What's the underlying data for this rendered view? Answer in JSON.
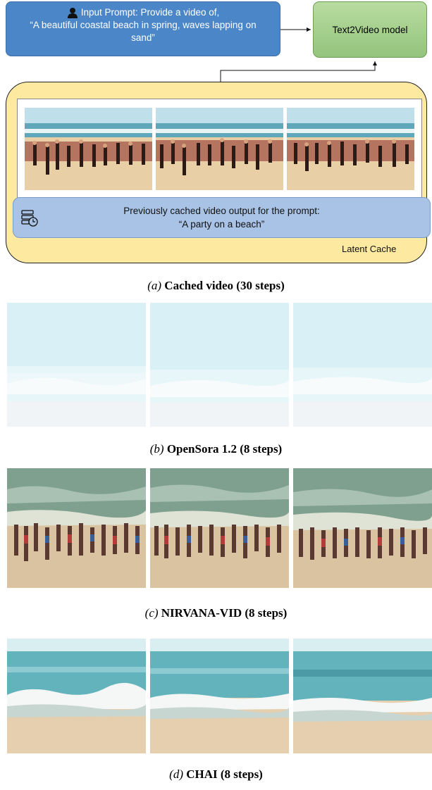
{
  "prompt": {
    "line1": "Input Prompt: Provide a video of,",
    "line2": "“A beautiful coastal beach in spring, waves lapping on",
    "line3": "sand”"
  },
  "model": {
    "label": "Text2Video model"
  },
  "cache": {
    "cached_line1": "Previously cached video output for the prompt:",
    "cached_line2": "“A party on a beach”",
    "latent_label": "Latent Cache"
  },
  "captions": [
    {
      "letter": "(a)",
      "title": "Cached video (30 steps)"
    },
    {
      "letter": "(b)",
      "title": "OpenSora 1.2 (8 steps)"
    },
    {
      "letter": "(c)",
      "title": "NIRVANA-VID (8 steps)"
    },
    {
      "letter": "(d)",
      "title": "CHAI (8 steps)"
    }
  ],
  "colors": {
    "prompt_box": "#4a86c8",
    "model_box": "#93c47d",
    "cache_box": "#fde9a0",
    "cached_bar": "#a8c3e6"
  }
}
